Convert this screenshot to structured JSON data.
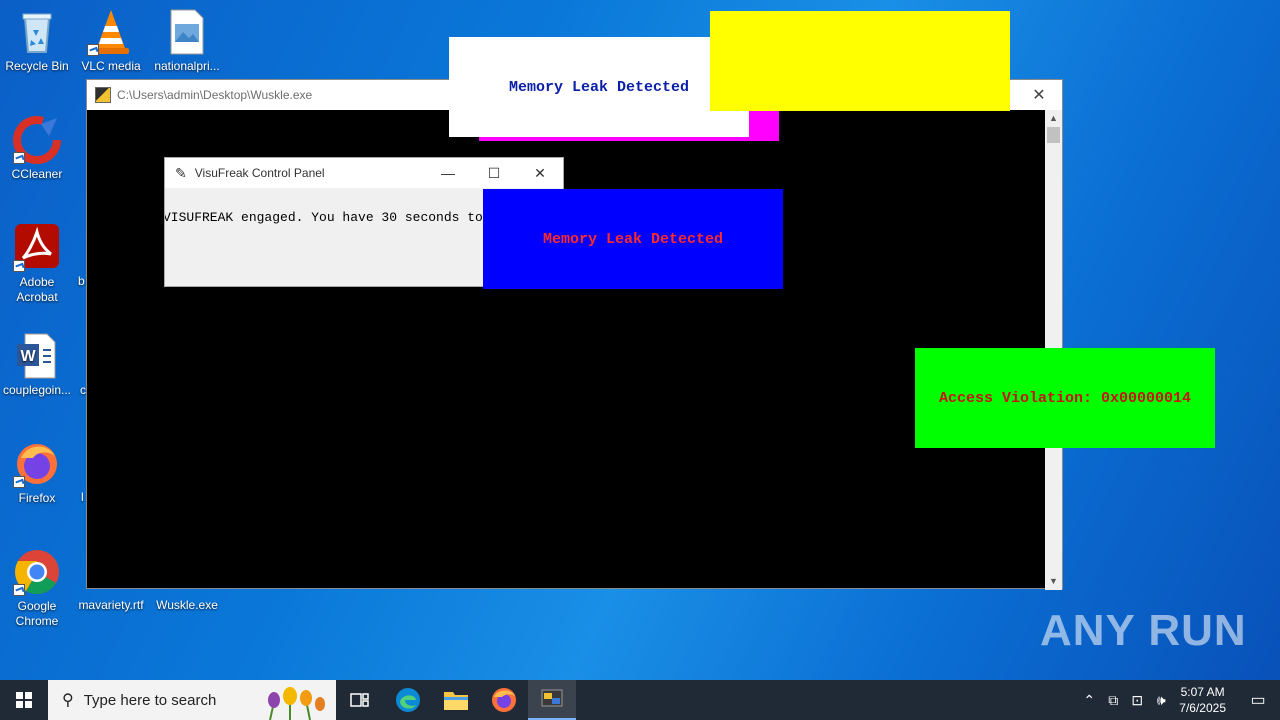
{
  "desktop": {
    "icons": [
      {
        "label": "Recycle Bin"
      },
      {
        "label": "VLC media"
      },
      {
        "label": "nationalpri..."
      },
      {
        "label": "CCleaner"
      },
      {
        "label": "Adobe Acrobat"
      },
      {
        "label": "couplegoin..."
      },
      {
        "label": "Firefox"
      },
      {
        "label": "Google Chrome"
      },
      {
        "label": "mavariety.rtf"
      },
      {
        "label": "Wuskle.exe"
      }
    ],
    "partial_labels": [
      "b",
      "c",
      "l"
    ]
  },
  "console_window": {
    "title": "C:\\Users\\admin\\Desktop\\Wuskle.exe",
    "close_glyph": "✕"
  },
  "control_panel": {
    "title": "VisuFreak Control Panel",
    "message": "VISUFREAK engaged. You have 30 seconds to"
  },
  "popups": {
    "memory_leak_white": {
      "text": "Memory Leak Detected",
      "bg": "#ffffff",
      "fg": "#0a1fa8"
    },
    "magenta_block": {
      "bg": "#ff00ff"
    },
    "yellow_block": {
      "bg": "#ffff00"
    },
    "memory_leak_blue": {
      "text": "Memory Leak Detected",
      "bg": "#0000ff",
      "fg": "#ff2a2a"
    },
    "access_violation": {
      "text": "Access Violation: 0x00000014",
      "bg": "#00ff00",
      "fg": "#cc1111"
    }
  },
  "taskbar": {
    "search_placeholder": "Type here to search",
    "time": "5:07 AM",
    "date": "7/6/2025"
  },
  "watermark": "ANY RUN"
}
